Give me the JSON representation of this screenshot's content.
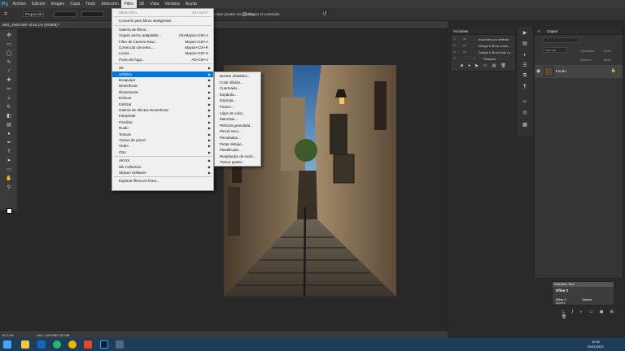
{
  "app": {
    "logo": "Ps"
  },
  "menubar": {
    "items": [
      "Archivo",
      "Edición",
      "Imagen",
      "Capa",
      "Texto",
      "Selección",
      "Filtro",
      "3D",
      "Vista",
      "Ventana",
      "Ayuda"
    ]
  },
  "options": {
    "preset": "Proporción",
    "hint": "Enderezar",
    "delete_cropped": "Eliminar píxeles recortados",
    "content_aware": "Según el contenido"
  },
  "document": {
    "tab": "IMG_1940.NEF al 62,1% (RGB/8) *",
    "zoom": "62,14%",
    "doc_info": "Doc: 2,80 MB/2,80 MB"
  },
  "filter_menu": {
    "items": [
      {
        "label": "Último filtro",
        "shortcut": "Alt+Ctrl+F",
        "disabled": true
      },
      {
        "sep": true
      },
      {
        "label": "Convertir para filtros inteligentes"
      },
      {
        "sep": true
      },
      {
        "label": "Galería de filtros..."
      },
      {
        "label": "Ángulo ancho adaptable...",
        "shortcut": "Alt+Mayús+Ctrl+A"
      },
      {
        "label": "Filtro de Camera Raw...",
        "shortcut": "Mayús+Ctrl+A"
      },
      {
        "label": "Corrección de lente...",
        "shortcut": "Mayús+Ctrl+R"
      },
      {
        "label": "Licuar...",
        "shortcut": "Mayús+Ctrl+X"
      },
      {
        "label": "Punto de fuga...",
        "shortcut": "Alt+Ctrl+V"
      },
      {
        "sep": true
      },
      {
        "label": "3D",
        "sub": true
      },
      {
        "label": "Artístico",
        "sub": true,
        "highlight": true
      },
      {
        "label": "Bosquejar",
        "sub": true
      },
      {
        "label": "Desenfocar",
        "sub": true
      },
      {
        "label": "Distorsionar",
        "sub": true
      },
      {
        "label": "Enfocar",
        "sub": true
      },
      {
        "label": "Estilizar",
        "sub": true
      },
      {
        "label": "Galería de efectos Desenfocar",
        "sub": true
      },
      {
        "label": "Interpretar",
        "sub": true
      },
      {
        "label": "Pixelizar",
        "sub": true
      },
      {
        "label": "Ruido",
        "sub": true
      },
      {
        "label": "Textura",
        "sub": true
      },
      {
        "label": "Trazos de pincel",
        "sub": true
      },
      {
        "label": "Vídeo",
        "sub": true
      },
      {
        "label": "Otro",
        "sub": true
      },
      {
        "sep": true
      },
      {
        "label": "AKVIS",
        "sub": true
      },
      {
        "label": "Nik Collection",
        "sub": true
      },
      {
        "label": "Skylum Software",
        "sub": true
      },
      {
        "sep": true
      },
      {
        "label": "Explorar filtros en línea..."
      }
    ]
  },
  "artistic_submenu": {
    "items": [
      "Bordes añadidos...",
      "Color diluido...",
      "Cuarteado...",
      "Espátula...",
      "Esponja...",
      "Fresco...",
      "Lápiz de color...",
      "Manchas...",
      "Película granulada...",
      "Pincel seco...",
      "Pinceladas...",
      "Pintar debajo...",
      "Plastificado...",
      "Resplandor de neón...",
      "Trazos pastel..."
    ]
  },
  "actions_panel": {
    "tab": "Acciones",
    "rows": [
      "Acciones por defecto",
      "Dodge & Burn auton...",
      "Dodge & Burn Auto (s...",
      "Sharpen"
    ]
  },
  "layers_panel": {
    "tab_ai": "Ai",
    "tab": "Capas",
    "kind": "Normal",
    "opacity_label": "Opacidad:",
    "opacity": "100%",
    "fill_label": "Relleno:",
    "fill": "100%",
    "layer_name": "Fondo"
  },
  "selective_tool": {
    "title": "Selective Tool",
    "items": [
      "Dfine 2",
      "Dfine 2",
      "Viveza"
    ],
    "footer": "Ajustes"
  },
  "taskbar": {
    "time": "11:30",
    "date": "09/11/2022"
  },
  "colors": {
    "accent": "#0078d7",
    "ps_blue": "#31a8ff",
    "taskbar": "#1f3c58"
  }
}
